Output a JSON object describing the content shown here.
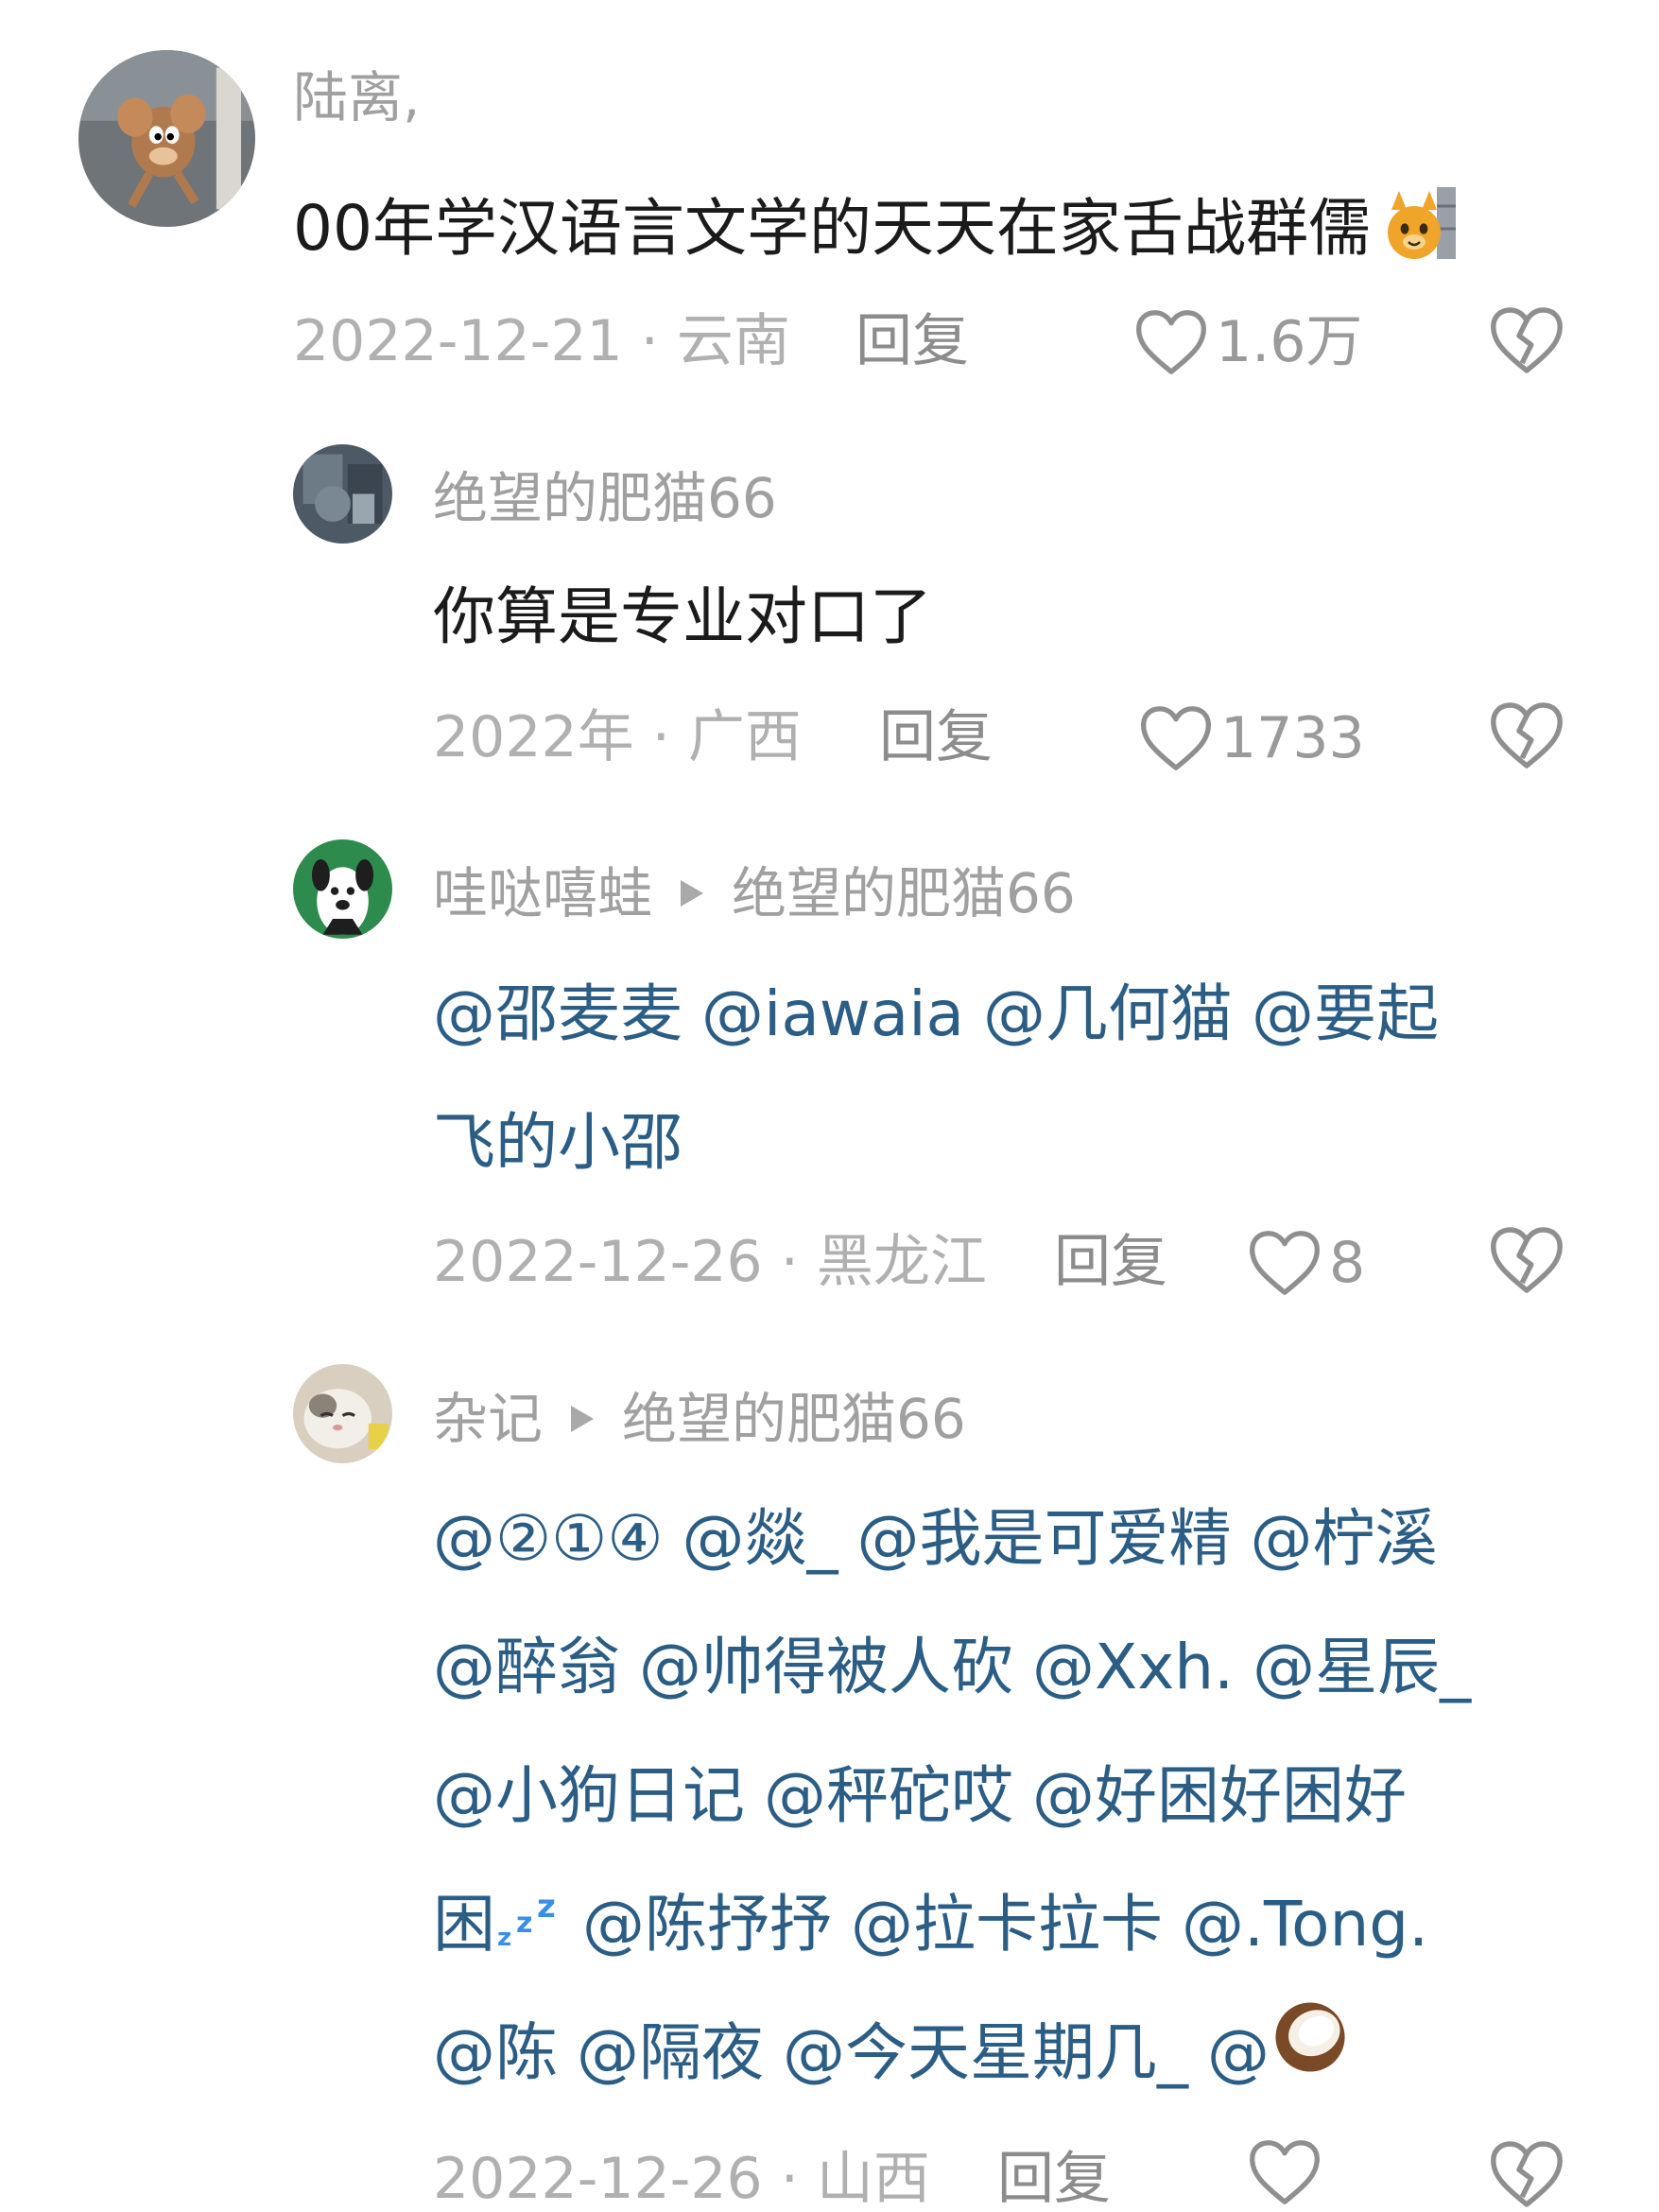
{
  "comments": [
    {
      "author": "陆离,",
      "text": "00年学汉语言文学的天天在家舌战群儒",
      "emoji": "cat-face-emoji",
      "date": "2022-12-21 · 云南",
      "reply_label": "回复",
      "likes": "1.6万"
    },
    {
      "author": "绝望的肥猫66",
      "text": "你算是专业对口了",
      "date": "2022年 · 广西",
      "reply_label": "回复",
      "likes": "1733"
    },
    {
      "author": "哇哒嘻蛙",
      "reply_to": "绝望的肥猫66",
      "mentions": [
        "@邵麦麦",
        "@iawaia",
        "@几何猫",
        "@要起",
        "飞的小邵"
      ],
      "date": "2022-12-26 · 黑龙江",
      "reply_label": "回复",
      "likes": "8"
    },
    {
      "author": "杂记",
      "reply_to": "绝望的肥猫66",
      "mention_lines": [
        [
          "@②①④",
          "@燚_",
          "@我是可爱精",
          "@柠溪"
        ],
        [
          "@醉翁",
          "@帅得被人砍",
          "@Xxh.",
          "@星辰_"
        ],
        [
          "@小狗日记",
          "@秤砣哎",
          "@好困好困好"
        ],
        [
          "困",
          "@陈抒抒",
          "@拉卡拉卡",
          "@.Tong."
        ],
        [
          "@陈",
          "@隔夜",
          "@今天星期几_",
          "@"
        ]
      ],
      "emojis": [
        "zzz-emoji",
        "coconut-emoji"
      ],
      "date": "2022-12-26 · 山西",
      "reply_label": "回复"
    }
  ],
  "colors": {
    "mention": "#2b5d85",
    "meta": "#b0b0b0",
    "username": "#a0a0a0",
    "text": "#1b1b1b"
  }
}
